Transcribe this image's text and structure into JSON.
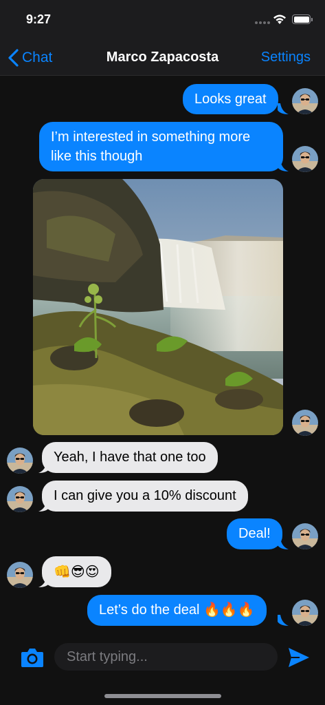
{
  "status_bar": {
    "time": "9:27",
    "battery_level": 1.0
  },
  "nav": {
    "back_label": "Chat",
    "title": "Marco Zapacosta",
    "settings_label": "Settings"
  },
  "messages": [
    {
      "direction": "out",
      "type": "text",
      "text": "Looks great"
    },
    {
      "direction": "out",
      "type": "text",
      "lines": [
        "I’m interested in something more",
        "like this though"
      ]
    },
    {
      "direction": "out",
      "type": "image",
      "icon": "waterfall-photo"
    },
    {
      "direction": "in",
      "type": "text",
      "text": "Yeah, I have that one too"
    },
    {
      "direction": "in",
      "type": "text",
      "text": "I can give you a 10% discount"
    },
    {
      "direction": "out",
      "type": "text",
      "text": "Deal!"
    },
    {
      "direction": "in",
      "type": "text",
      "text": "👊😎😍"
    },
    {
      "direction": "out",
      "type": "text",
      "text": "Let’s do the deal 🔥🔥🔥"
    }
  ],
  "composer": {
    "placeholder": "Start typing...",
    "camera_icon": "camera-icon",
    "send_icon": "send-icon"
  },
  "colors": {
    "accent": "#0a84ff",
    "outgoing_bubble": "#0a84ff",
    "incoming_bubble": "#e9e9eb",
    "background": "#111111"
  }
}
